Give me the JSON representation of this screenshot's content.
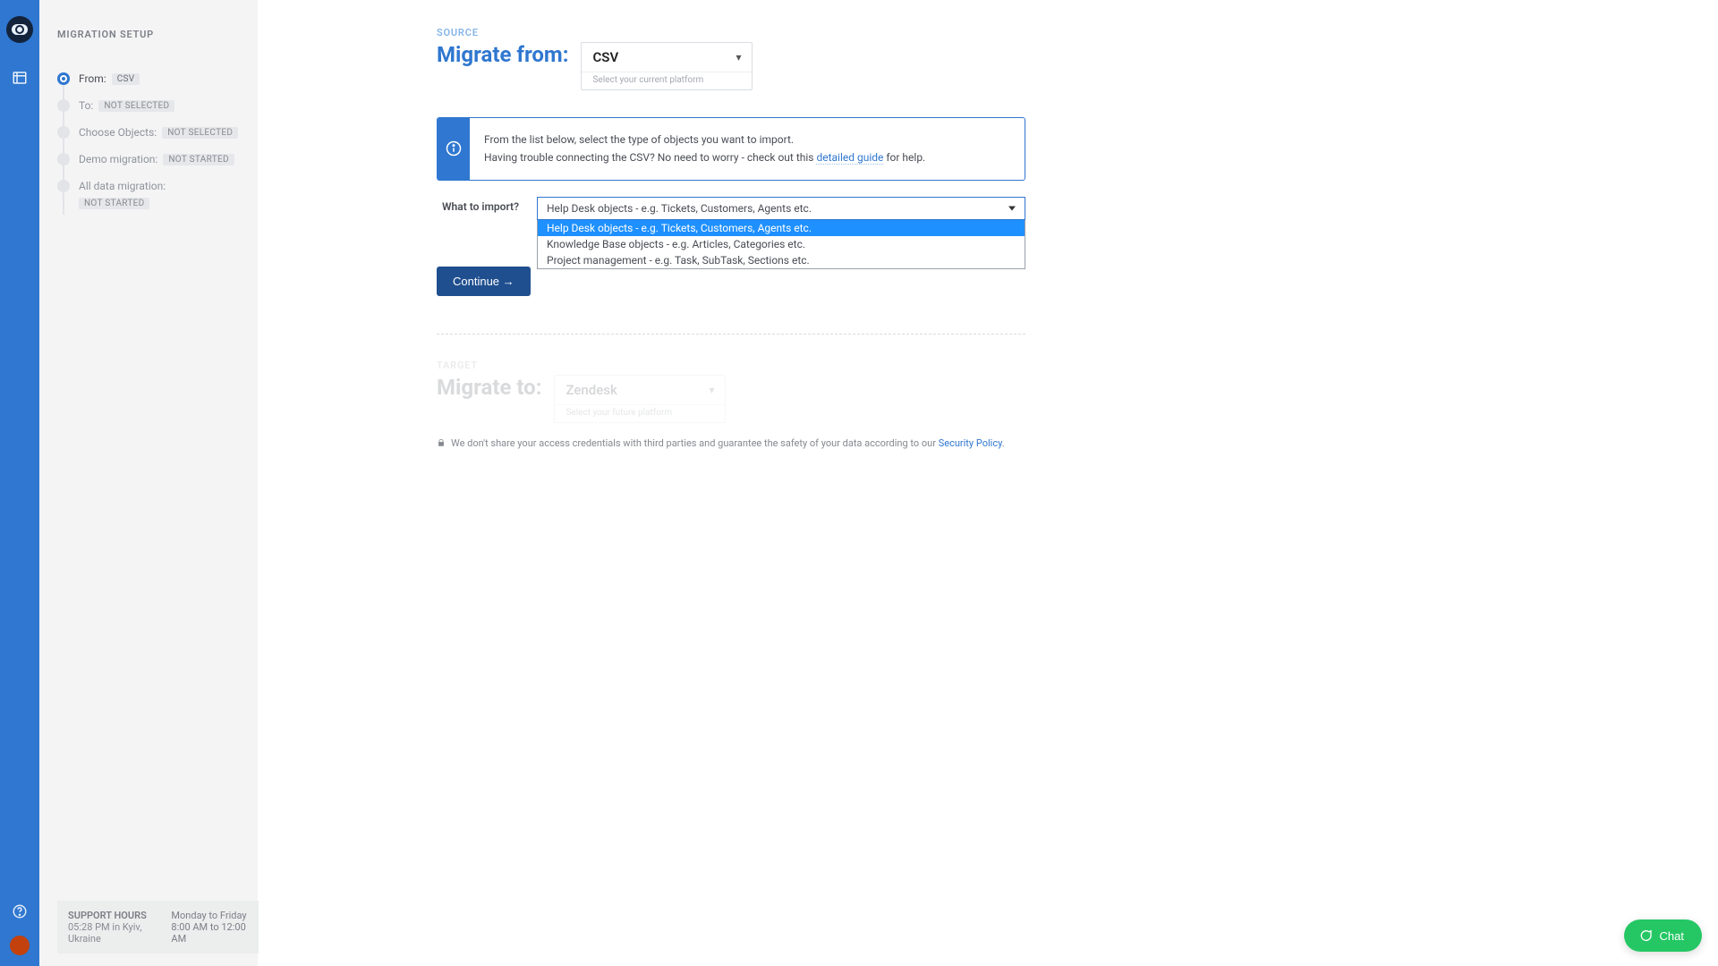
{
  "sidebar": {
    "title": "MIGRATION SETUP",
    "steps": [
      {
        "label": "From:",
        "chip": "CSV",
        "state": "active"
      },
      {
        "label": "To:",
        "chip": "NOT SELECTED"
      },
      {
        "label": "Choose Objects:",
        "chip": "NOT SELECTED"
      },
      {
        "label": "Demo migration:",
        "chip": "NOT STARTED"
      },
      {
        "label": "All data migration:",
        "chip": "NOT STARTED"
      }
    ],
    "support": {
      "title": "SUPPORT HOURS",
      "localTime": "05:28 PM in Kyiv, Ukraine",
      "days": "Monday to Friday",
      "hours": "8:00 AM to 12:00 AM"
    }
  },
  "source": {
    "eyebrow": "SOURCE",
    "heading": "Migrate from:",
    "selectedPlatform": "CSV",
    "platformHint": "Select your current platform",
    "info": {
      "line1": "From the list below, select the type of objects you want to import.",
      "line2a": "Having trouble connecting the CSV? No need to worry - check out this ",
      "linkText": "detailed guide",
      "line2b": " for help."
    },
    "importLabel": "What to import?",
    "importSelected": "Help Desk objects - e.g. Tickets, Customers, Agents etc.",
    "importOptions": [
      "Help Desk objects - e.g. Tickets, Customers, Agents etc.",
      "Knowledge Base objects - e.g. Articles, Categories etc.",
      "Project management - e.g. Task, SubTask, Sections etc."
    ],
    "continueLabel": "Continue →"
  },
  "target": {
    "eyebrow": "TARGET",
    "heading": "Migrate to:",
    "selectedPlatform": "Zendesk",
    "platformHint": "Select your future platform"
  },
  "security": {
    "text": "We don't share your access credentials with third parties and guarantee the safety of your data according to our ",
    "linkText": "Security Policy"
  },
  "chatLabel": "Chat"
}
